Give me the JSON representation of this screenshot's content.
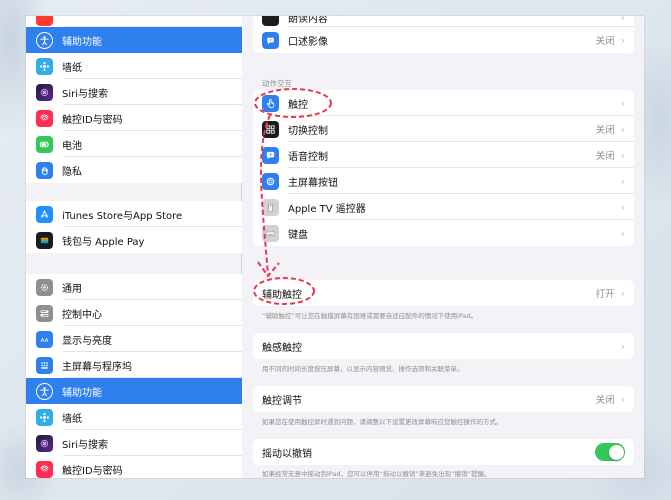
{
  "sidebar": {
    "group1": [
      {
        "label": "",
        "icon": "partial-icon"
      },
      {
        "label": "辅助功能",
        "icon": "accessibility-icon",
        "active": true
      },
      {
        "label": "墙纸",
        "icon": "wallpaper-icon"
      },
      {
        "label": "Siri与搜索",
        "icon": "siri-icon"
      },
      {
        "label": "触控ID与密码",
        "icon": "fingerprint-icon"
      },
      {
        "label": "电池",
        "icon": "battery-icon"
      },
      {
        "label": "隐私",
        "icon": "privacy-hand-icon"
      }
    ],
    "group2": [
      {
        "label": "iTunes Store与App Store",
        "icon": "app-store-icon"
      },
      {
        "label": "钱包与 Apple Pay",
        "icon": "wallet-icon"
      }
    ],
    "group3": [
      {
        "label": "通用",
        "icon": "gear-icon"
      },
      {
        "label": "控制中心",
        "icon": "control-center-icon"
      },
      {
        "label": "显示与亮度",
        "icon": "display-brightness-icon"
      },
      {
        "label": "主屏幕与程序坞",
        "icon": "home-screen-icon"
      },
      {
        "label": "辅助功能",
        "icon": "accessibility-icon",
        "active": true
      },
      {
        "label": "墙纸",
        "icon": "wallpaper-icon"
      },
      {
        "label": "Siri与搜索",
        "icon": "siri-icon"
      },
      {
        "label": "触控ID与密码",
        "icon": "fingerprint-icon"
      }
    ]
  },
  "main": {
    "top_card": [
      {
        "label": "朗读内容",
        "value": "",
        "icon": "speech-icon"
      },
      {
        "label": "口述影像",
        "value": "关闭",
        "icon": "audio-description-icon"
      }
    ],
    "interaction_header": "动作交互",
    "interaction_rows": [
      {
        "label": "触控",
        "value": "",
        "icon": "touch-hand-icon"
      },
      {
        "label": "切换控制",
        "value": "关闭",
        "icon": "switch-control-icon"
      },
      {
        "label": "语音控制",
        "value": "关闭",
        "icon": "voice-control-icon"
      },
      {
        "label": "主屏幕按钮",
        "value": "",
        "icon": "home-button-icon"
      },
      {
        "label": "Apple TV 遥控器",
        "value": "",
        "icon": "remote-icon"
      },
      {
        "label": "键盘",
        "value": "",
        "icon": "keyboard-icon"
      }
    ],
    "assistive_touch": {
      "label": "辅助触控",
      "value": "打开",
      "footer": "“辅助触控”可让您在触摸屏幕有困难或需要自适应配件的情况下使用iPad。"
    },
    "haptic_touch": {
      "label": "触感触控",
      "footer": "用不同的时间长度按压屏幕，以显示内容预览、操作选项和关联菜单。"
    },
    "touch_accommodations": {
      "label": "触控调节",
      "value": "关闭",
      "footer": "如果您在使用触控屏时遇到问题，请调整以下设置更改屏幕响应您触控操作的方式。"
    },
    "shake_to_undo": {
      "label": "摇动以撤销",
      "footer": "如果经常无意中摇动到iPad，您可以停用“摇动以撤销”来避免出现“撤销”提醒。"
    }
  },
  "colors": {
    "accent": "#2f80ed",
    "toggle_on": "#34c759",
    "annotation": "#e53950"
  }
}
